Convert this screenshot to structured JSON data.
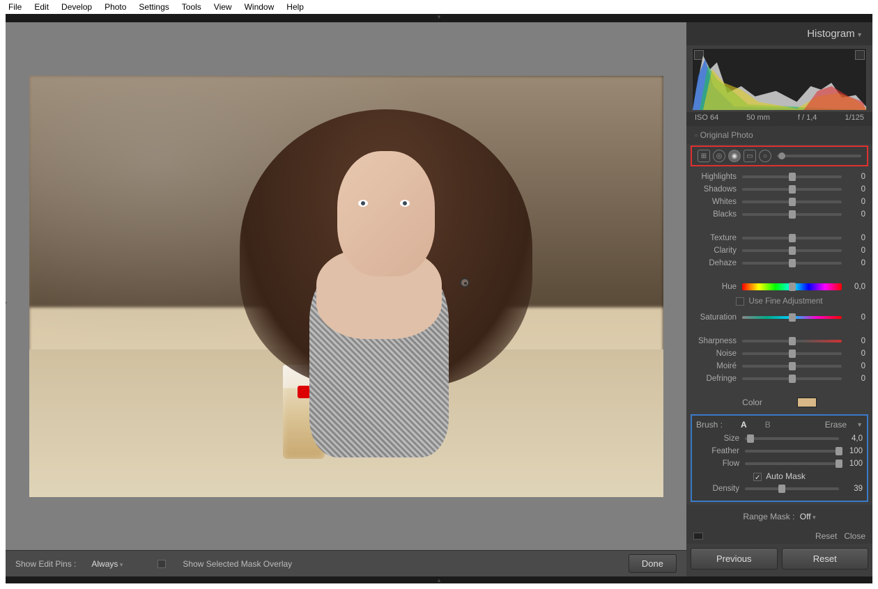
{
  "menu": [
    "File",
    "Edit",
    "Develop",
    "Photo",
    "Settings",
    "Tools",
    "View",
    "Window",
    "Help"
  ],
  "panel_header": "Histogram",
  "histo_info": {
    "iso": "ISO 64",
    "focal": "50 mm",
    "ap": "f / 1,4",
    "shutter": "1/125"
  },
  "orig_photo": "Original Photo",
  "sliders_basic": [
    {
      "lbl": "Highlights",
      "val": "0",
      "pos": 50
    },
    {
      "lbl": "Shadows",
      "val": "0",
      "pos": 50
    },
    {
      "lbl": "Whites",
      "val": "0",
      "pos": 50
    },
    {
      "lbl": "Blacks",
      "val": "0",
      "pos": 50
    }
  ],
  "sliders_tex": [
    {
      "lbl": "Texture",
      "val": "0",
      "pos": 50
    },
    {
      "lbl": "Clarity",
      "val": "0",
      "pos": 50
    },
    {
      "lbl": "Dehaze",
      "val": "0",
      "pos": 50
    }
  ],
  "hue": {
    "lbl": "Hue",
    "val": "0,0",
    "pos": 50
  },
  "fine_adj": "Use Fine Adjustment",
  "saturation": {
    "lbl": "Saturation",
    "val": "0",
    "pos": 50
  },
  "sliders_det": [
    {
      "lbl": "Sharpness",
      "val": "0",
      "pos": 50
    },
    {
      "lbl": "Noise",
      "val": "0",
      "pos": 50
    },
    {
      "lbl": "Moiré",
      "val": "0",
      "pos": 50
    },
    {
      "lbl": "Defringe",
      "val": "0",
      "pos": 50
    }
  ],
  "color": {
    "lbl": "Color",
    "swatch": "#d8b888"
  },
  "brush": {
    "hdr": "Brush :",
    "A": "A",
    "B": "B",
    "erase": "Erase",
    "rows": [
      {
        "lbl": "Size",
        "val": "4,0",
        "pos": 6
      },
      {
        "lbl": "Feather",
        "val": "100",
        "pos": 100
      },
      {
        "lbl": "Flow",
        "val": "100",
        "pos": 100
      }
    ],
    "automask": "Auto Mask",
    "density": {
      "lbl": "Density",
      "val": "39",
      "pos": 39
    }
  },
  "range_mask": {
    "lbl": "Range Mask :",
    "val": "Off"
  },
  "mini": {
    "reset": "Reset",
    "close": "Close"
  },
  "big_btns": {
    "prev": "Previous",
    "reset": "Reset"
  },
  "canvas_bar": {
    "pins_lbl": "Show Edit Pins :",
    "pins_val": "Always",
    "overlay": "Show Selected Mask Overlay",
    "done": "Done"
  }
}
